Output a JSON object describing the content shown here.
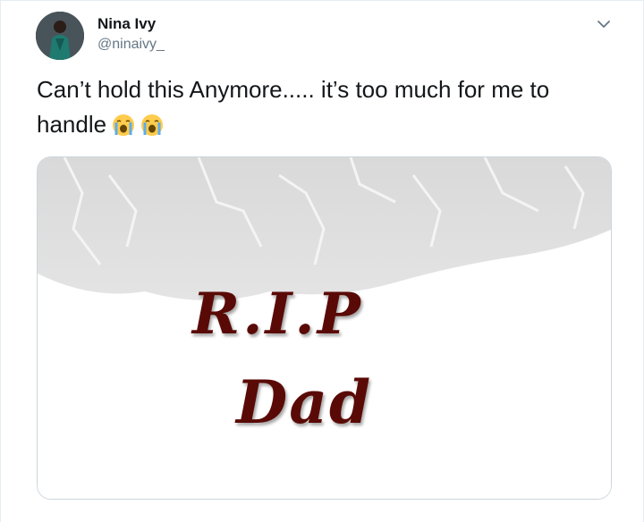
{
  "tweet": {
    "display_name": "Nina Ivy",
    "handle": "@ninaivy_",
    "text": "Can’t hold this Anymore..... it’s too much for me to handle",
    "emojis": [
      "loudly-crying-face",
      "loudly-crying-face"
    ]
  },
  "media": {
    "line1": "R.I.P",
    "line2": "Dad"
  },
  "colors": {
    "text_primary": "#14171a",
    "text_secondary": "#657786",
    "border": "#ccd6dd",
    "rip_text": "#5a0a06"
  }
}
